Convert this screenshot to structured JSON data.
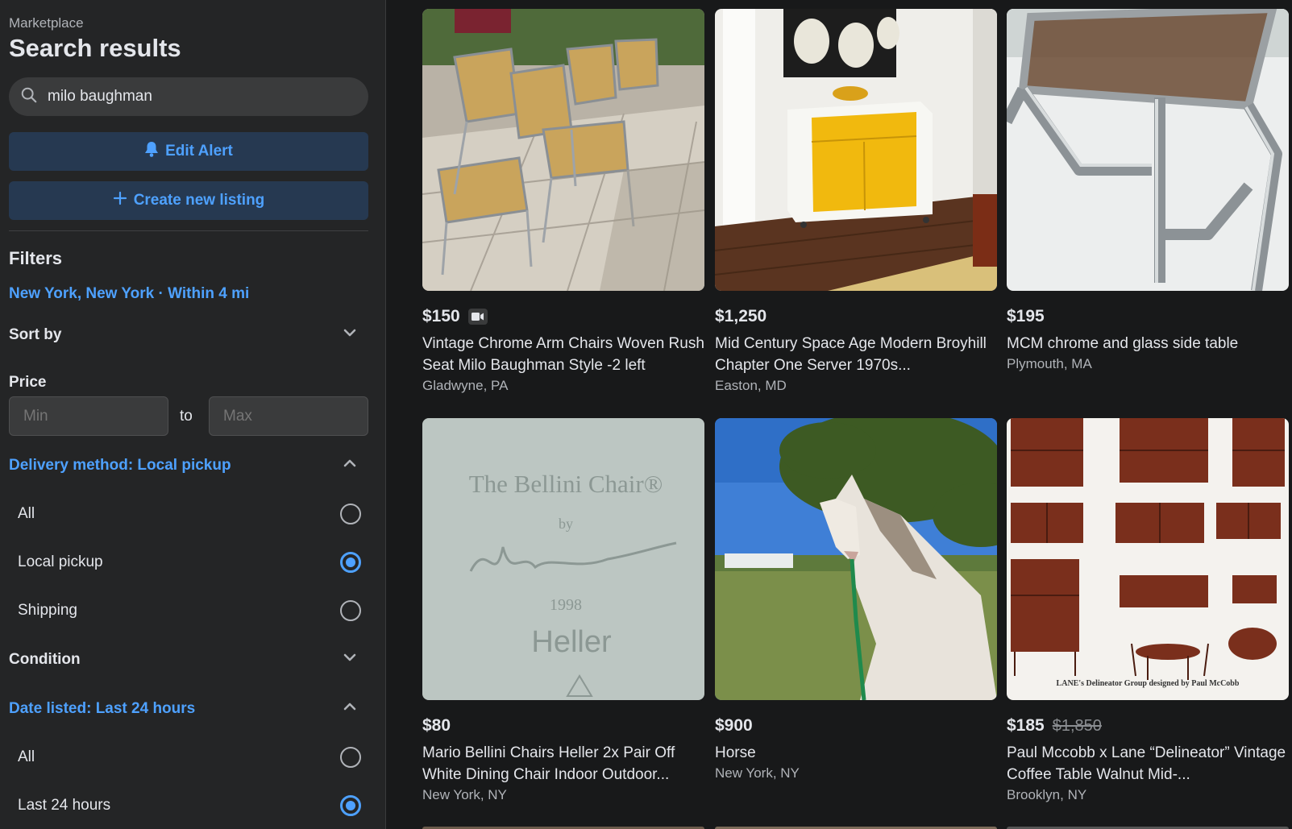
{
  "sidebar": {
    "breadcrumb": "Marketplace",
    "title": "Search results",
    "search": {
      "value": "milo baughman"
    },
    "edit_alert": "Edit Alert",
    "create_listing": "Create new listing",
    "filters_heading": "Filters",
    "location": "New York, New York · Within 4 mi",
    "sort_by": "Sort by",
    "price_label": "Price",
    "price_min_placeholder": "Min",
    "price_to": "to",
    "price_max_placeholder": "Max",
    "delivery": {
      "heading": "Delivery method: Local pickup",
      "options": [
        {
          "label": "All",
          "selected": false
        },
        {
          "label": "Local pickup",
          "selected": true
        },
        {
          "label": "Shipping",
          "selected": false
        }
      ]
    },
    "condition": "Condition",
    "date_listed": {
      "heading": "Date listed: Last 24 hours",
      "options": [
        {
          "label": "All",
          "selected": false
        },
        {
          "label": "Last 24 hours",
          "selected": true
        }
      ]
    }
  },
  "listings": [
    {
      "price": "$150",
      "old_price": "",
      "title": "Vintage Chrome Arm Chairs Woven Rush Seat Milo Baughman Style -2 left",
      "location": "Gladwyne, PA",
      "has_video": true
    },
    {
      "price": "$1,250",
      "old_price": "",
      "title": "Mid Century Space Age Modern Broyhill Chapter One Server 1970s...",
      "location": "Easton, MD",
      "has_video": false
    },
    {
      "price": "$195",
      "old_price": "",
      "title": "MCM chrome and glass side table",
      "location": "Plymouth, MA",
      "has_video": false
    },
    {
      "price": "$80",
      "old_price": "",
      "title": "Mario Bellini Chairs Heller 2x Pair Off White Dining Chair Indoor Outdoor...",
      "location": "New York, NY",
      "has_video": false
    },
    {
      "price": "$900",
      "old_price": "",
      "title": "Horse",
      "location": "New York, NY",
      "has_video": false
    },
    {
      "price": "$185",
      "old_price": "$1,850",
      "title": "Paul Mccobb x Lane “Delineator” Vintage Coffee Table Walnut Mid-...",
      "location": "Brooklyn, NY",
      "has_video": false
    }
  ],
  "image_text": {
    "bellini_line1": "The Bellini Chair®",
    "bellini_line2": "by",
    "bellini_year": "1998",
    "bellini_brand": "Heller",
    "lane_caption": "LANE's Delineator Group designed by Paul McCobb"
  },
  "colors": {
    "accent": "#4ea1ff",
    "button_bg": "#263951",
    "background": "#18191a",
    "sidebar": "#242526"
  }
}
